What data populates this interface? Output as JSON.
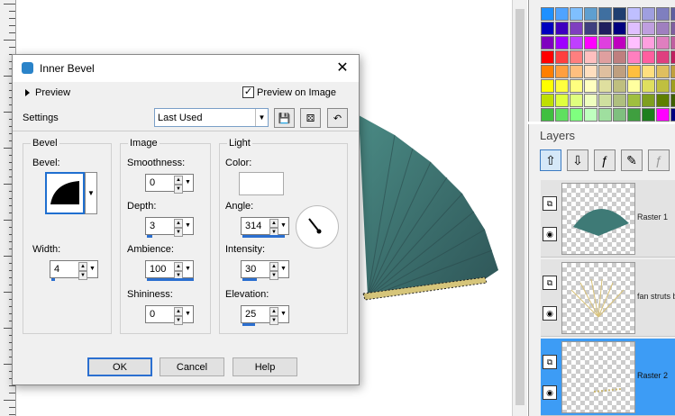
{
  "dialog": {
    "title": "Inner Bevel",
    "preview_label": "Preview",
    "preview_on_image_label": "Preview on Image",
    "preview_on_image_checked": true,
    "settings_label": "Settings",
    "preset_value": "Last Used",
    "bevel": {
      "group_title": "Bevel",
      "bevel_label": "Bevel:",
      "width_label": "Width:",
      "width_value": "4"
    },
    "image": {
      "group_title": "Image",
      "smoothness_label": "Smoothness:",
      "smoothness_value": "0",
      "depth_label": "Depth:",
      "depth_value": "3",
      "ambience_label": "Ambience:",
      "ambience_value": "100",
      "shininess_label": "Shininess:",
      "shininess_value": "0"
    },
    "light": {
      "group_title": "Light",
      "color_label": "Color:",
      "color_value": "#ffffff",
      "angle_label": "Angle:",
      "angle_value": "314",
      "intensity_label": "Intensity:",
      "intensity_value": "30",
      "elevation_label": "Elevation:",
      "elevation_value": "25"
    },
    "buttons": {
      "ok": "OK",
      "cancel": "Cancel",
      "help": "Help"
    }
  },
  "layers_panel": {
    "title": "Layers",
    "layers": [
      {
        "name": "Raster 1",
        "selected": false
      },
      {
        "name": "fan struts b",
        "selected": false
      },
      {
        "name": "Raster 2",
        "selected": true
      }
    ]
  },
  "swatch_colors": [
    "#1e90ff",
    "#4fa3ff",
    "#7fbfff",
    "#5f9fd0",
    "#3f6fa0",
    "#1f3f70",
    "#bfbfff",
    "#9f9fdf",
    "#7f7fbf",
    "#5f5f9f",
    "#0000bf",
    "#3f00bf",
    "#7f3fbf",
    "#3f3f7f",
    "#1f1f5f",
    "#00007f",
    "#dfbfff",
    "#bf9fdf",
    "#9f7fbf",
    "#7f5f9f",
    "#7f00bf",
    "#9f00ff",
    "#bf3fff",
    "#ff00ff",
    "#df3fdf",
    "#bf00bf",
    "#ffbfff",
    "#ff9fdf",
    "#df7fbf",
    "#bf5f9f",
    "#ff0000",
    "#ff3f3f",
    "#ff7f7f",
    "#ffbfbf",
    "#df9f9f",
    "#bf7f7f",
    "#ff7fbf",
    "#ff5f9f",
    "#df3f7f",
    "#bf1f5f",
    "#ff7f00",
    "#ff9f3f",
    "#ffbf7f",
    "#ffdfbf",
    "#dfbf9f",
    "#bf9f7f",
    "#ffbf3f",
    "#ffdf7f",
    "#dfbf5f",
    "#bf9f3f",
    "#ffff00",
    "#ffff3f",
    "#ffff7f",
    "#ffffbf",
    "#dfdf9f",
    "#bfbf7f",
    "#ffff9f",
    "#dfdf5f",
    "#bfbf3f",
    "#9f9f1f",
    "#bfdf00",
    "#dfff3f",
    "#dfff7f",
    "#efffbf",
    "#cfdf9f",
    "#afbf7f",
    "#9fbf3f",
    "#7f9f1f",
    "#5f7f00",
    "#3f5f00",
    "#3fbf3f",
    "#5fdf5f",
    "#7fff7f",
    "#bfffbf",
    "#9fdf9f",
    "#7fbf7f",
    "#3f9f3f",
    "#1f7f1f",
    "#ff00ff",
    "#00007f"
  ]
}
